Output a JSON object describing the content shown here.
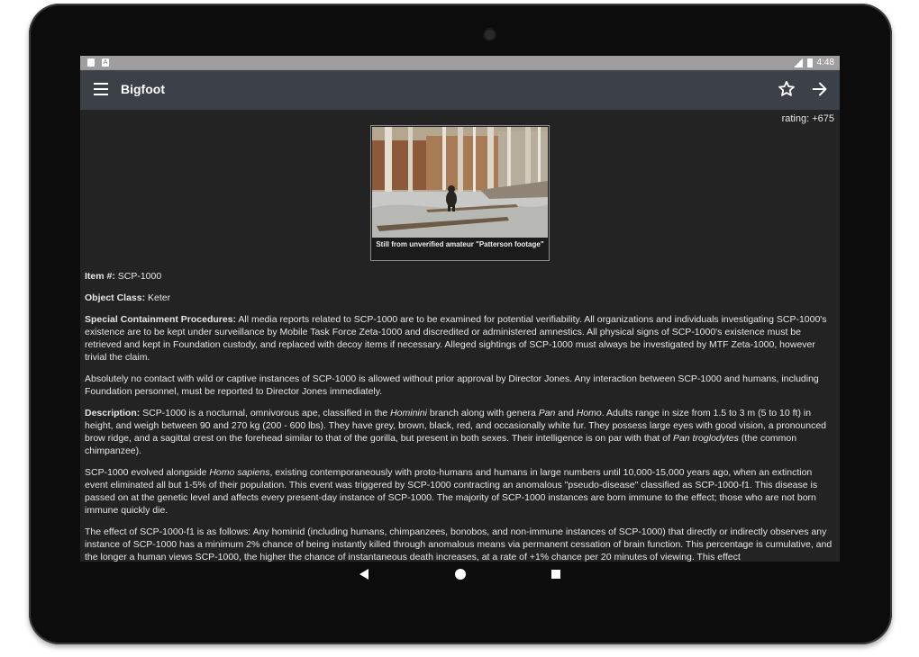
{
  "statusbar": {
    "time": "4:48"
  },
  "appbar": {
    "title": "Bigfoot"
  },
  "rating": "rating: +675",
  "figure": {
    "caption": "Still from unverified amateur \"Patterson footage\""
  },
  "article": {
    "item_label": "Item #:",
    "item_value": " SCP-1000",
    "class_label": "Object Class:",
    "class_value": " Keter",
    "scp_label": "Special Containment Procedures:",
    "scp_text": " All media reports related to SCP-1000 are to be examined for potential verifiability. All organizations and individuals investigating SCP-1000's existence are to be kept under surveillance by Mobile Task Force Zeta-1000 and discredited or administered amnestics. All physical signs of SCP-1000's existence must be retrieved and kept in Foundation custody, and replaced with decoy items if necessary. Alleged sightings of SCP-1000 must always be investigated by MTF Zeta-1000, however trivial the claim.",
    "para2": "Absolutely no contact with wild or captive instances of SCP-1000 is allowed without prior approval by Director Jones. Any interaction between SCP-1000 and humans, including Foundation personnel, must be reported to Director Jones immediately.",
    "desc_label": "Description:",
    "desc_1": " SCP-1000 is a nocturnal, omnivorous ape, classified in the ",
    "desc_hominini": "Hominini",
    "desc_2": " branch along with genera ",
    "desc_pan": "Pan",
    "desc_3": " and ",
    "desc_homo": "Homo",
    "desc_4": ". Adults range in size from 1.5 to 3 m (5 to 10 ft) in height, and weigh between 90 and 270 kg (200 - 600 lbs). They have grey, brown, black, red, and occasionally white fur. They possess large eyes with good vision, a pronounced brow ridge, and a sagittal crest on the forehead similar to that of the gorilla, but present in both sexes. Their intelligence is on par with that of ",
    "desc_pantrog": "Pan troglodytes",
    "desc_5": " (the common chimpanzee).",
    "evo_1": "SCP-1000 evolved alongside ",
    "evo_homosap": "Homo sapiens",
    "evo_2": ", existing contemporaneously with proto-humans and humans in large numbers until 10,000-15,000 years ago, when an extinction event eliminated all but 1-5% of their population. This event was triggered by SCP-1000 contracting an anomalous \"pseudo-disease\" classified as SCP-1000-f1. This disease is passed on at the genetic level and affects every present-day instance of SCP-1000. The majority of SCP-1000 instances are born immune to the effect; those who are not born immune quickly die.",
    "effect": "The effect of SCP-1000-f1 is as follows: Any hominid (including humans, chimpanzees, bonobos, and non-immune instances of SCP-1000) that directly or indirectly observes any instance of SCP-1000 has a minimum 2% chance of being instantly killed through anomalous means via permanent cessation of brain function. This percentage is cumulative, and the longer a human views SCP-1000, the higher the chance of instantaneous death increases, at a rate of +1% chance per 20 minutes of viewing. This effect"
  },
  "icons": {
    "menu": "menu-icon",
    "star": "star-outline-icon",
    "forward": "arrow-forward-icon",
    "back": "nav-back-icon",
    "home": "nav-home-icon",
    "recents": "nav-recents-icon"
  },
  "colors": {
    "appbar": "#3b4146",
    "statusbar": "#9e9e9e",
    "background": "#232323",
    "text": "#e6e6e6"
  }
}
